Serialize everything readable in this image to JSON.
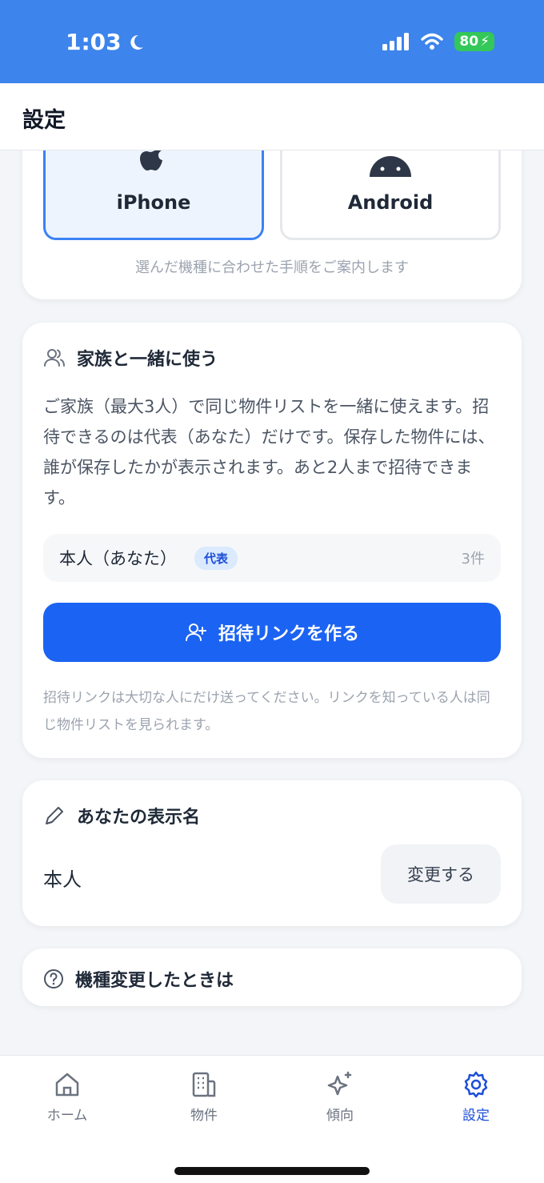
{
  "status": {
    "time": "1:03",
    "battery": "80"
  },
  "header": {
    "title": "設定"
  },
  "device": {
    "options": [
      {
        "label": "iPhone"
      },
      {
        "label": "Android"
      }
    ],
    "hint": "選んだ機種に合わせた手順をご案内します"
  },
  "family": {
    "title": "家族と一緒に使う",
    "description": "ご家族（最大3人）で同じ物件リストを一緒に使えます。招待できるのは代表（あなた）だけです。保存した物件には、誰が保存したかが表示されます。あと2人まで招待できます。",
    "member": {
      "name": "本人（あなた）",
      "badge": "代表",
      "count": "3件"
    },
    "invite_label": "招待リンクを作る",
    "note": "招待リンクは大切な人にだけ送ってください。リンクを知っている人は同じ物件リストを見られます。"
  },
  "display_name": {
    "title": "あなたの表示名",
    "value": "本人",
    "change_label": "変更する"
  },
  "model_change": {
    "title": "機種変更したときは"
  },
  "tabs": [
    {
      "label": "ホーム",
      "icon": "home-icon"
    },
    {
      "label": "物件",
      "icon": "building-icon"
    },
    {
      "label": "傾向",
      "icon": "sparkles-icon"
    },
    {
      "label": "設定",
      "icon": "gear-icon"
    }
  ],
  "colors": {
    "accent": "#1b63f2",
    "status_bar": "#3d84ec",
    "active_tab": "#1d4ed8"
  }
}
